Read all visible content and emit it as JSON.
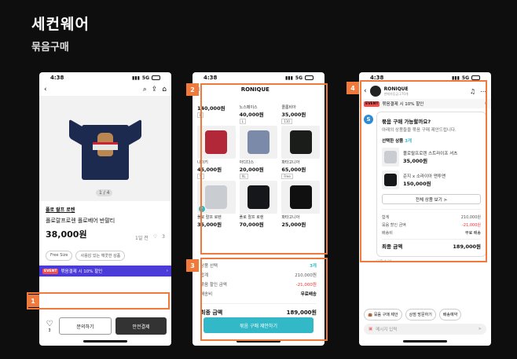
{
  "header": {
    "title": "세컨웨어",
    "subtitle": "묶음구매"
  },
  "markers": [
    "1",
    "2",
    "3",
    "4"
  ],
  "status": {
    "time": "4:38",
    "network": "5G",
    "battery": "47"
  },
  "screen1": {
    "image_counter": "1 / 4",
    "brand": "폴로 랄프 로렌",
    "product_name": "폴로랄프로렌 폴로베어 반팔티",
    "price": "38,000원",
    "views": "1일 전",
    "likes": "3",
    "chips": [
      "Free Size",
      "사용감 있는 깨끗한 상품"
    ],
    "event_badge": "EVENT",
    "event_text": "묶음결제 시 10% 할인",
    "heart_count": "3",
    "inquiry_button": "문의하기",
    "pay_button": "안전결제"
  },
  "screen2": {
    "store": "RONIQUE",
    "top_row": [
      {
        "name": "",
        "price": "140,000원",
        "size": "L"
      },
      {
        "name": "노스페이스",
        "price": "40,000원",
        "size": "L"
      },
      {
        "name": "콜롬비아",
        "price": "35,000원",
        "size": "110"
      }
    ],
    "products": [
      {
        "name": "나이키",
        "price": "45,000원",
        "size": "S",
        "color": "#b22838"
      },
      {
        "name": "아디다스",
        "price": "20,000원",
        "size": "XL",
        "color": "#7a8aa8"
      },
      {
        "name": "파타고니아",
        "price": "65,000원",
        "size": "Free",
        "color": "#1a1d1a"
      },
      {
        "name": "폴로 랄프 로렌",
        "price": "35,000원",
        "size": "",
        "color": "#c9ccd0",
        "checked": true
      },
      {
        "name": "폴로 랄프 로렌",
        "price": "70,000원",
        "size": "",
        "color": "#15171a"
      },
      {
        "name": "파타고니아",
        "price": "25,000원",
        "size": "",
        "color": "#101010"
      }
    ],
    "summary": {
      "selected_label": "상품 선택",
      "selected_value": "3개",
      "sum_label": "합계",
      "sum_value": "210,000원",
      "discount_label": "묶음 할인 금액",
      "discount_value": "-21,000원",
      "shipping_label": "배송비",
      "shipping_value": "무료배송",
      "total_label": "최종 금액",
      "total_value": "189,000원"
    },
    "cta": "묶음 구매 제안하기"
  },
  "screen3": {
    "store": "RONIQUE",
    "store_sub": "판매자등급 270개",
    "event_badge": "EVENT",
    "event_text": "묶음결제 시 10% 할인",
    "bot_letter": "S",
    "question": "묶음 구매 가능할까요?",
    "question_sub": "아래의 상품들을 묶음 구매 제안드립니다.",
    "selected_label": "선택한 상품",
    "selected_count": "3개",
    "items": [
      {
        "name": "폴로랄프로렌 스트라이프 셔츠",
        "price": "35,000원",
        "color": "#c9ccd0"
      },
      {
        "name": "준지 x 소라이아 맨투맨",
        "price": "150,000원",
        "color": "#15171a"
      }
    ],
    "all_button": "전체 상품 보기 >",
    "sum_label": "합계",
    "sum_value": "210,000원",
    "discount_label": "묶음 할인 금액",
    "discount_value": "-21,000원",
    "shipping_label": "배송비",
    "shipping_value": "무료 배송",
    "total_label": "최종 금액",
    "total_value": "189,000원",
    "time": "오후 4:36",
    "quick_replies": [
      "묶음 구매 제안",
      "상점 방문하기",
      "배송예약"
    ],
    "input_placeholder": "메시지 입력"
  }
}
